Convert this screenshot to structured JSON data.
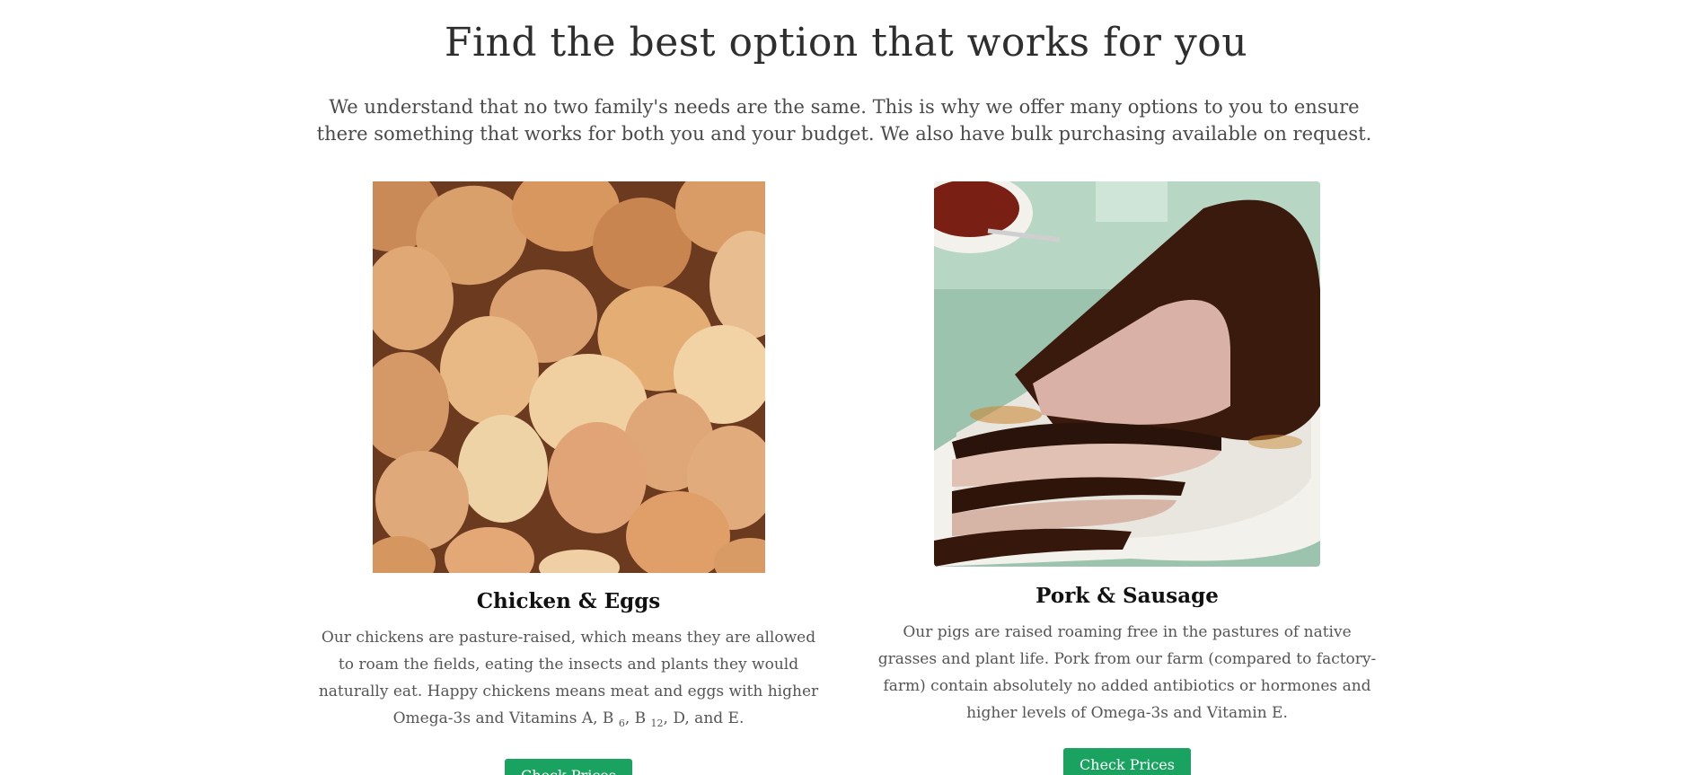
{
  "heading": "Find the best option that works for you",
  "intro": "We understand that no two family's needs are the same. This is why we offer many options to you to ensure there something that works for both you and your budget. We also have bulk purchasing available on request.",
  "cards": [
    {
      "title": "Chicken & Eggs",
      "text_before": "Our chickens are pasture-raised, which means they are allowed to roam the fields, eating the insects and plants they would naturally eat. Happy chickens means meat and eggs with higher Omega-3s and Vitamins A, B",
      "sub1": "6",
      "text_mid": ", B",
      "sub2": "12",
      "text_after": ", D, and E.",
      "button": "Check Prices"
    },
    {
      "title": "Pork & Sausage",
      "text": "Our pigs are raised roaming free in the pastures of native grasses and plant life. Pork from our farm (compared to factory-farm) contain absolutely no added antibiotics or hormones and higher levels of Omega-3s and Vitamin E.",
      "button": "Check Prices"
    }
  ],
  "colors": {
    "button": "#1aa260",
    "heading": "#2e2e2e"
  }
}
